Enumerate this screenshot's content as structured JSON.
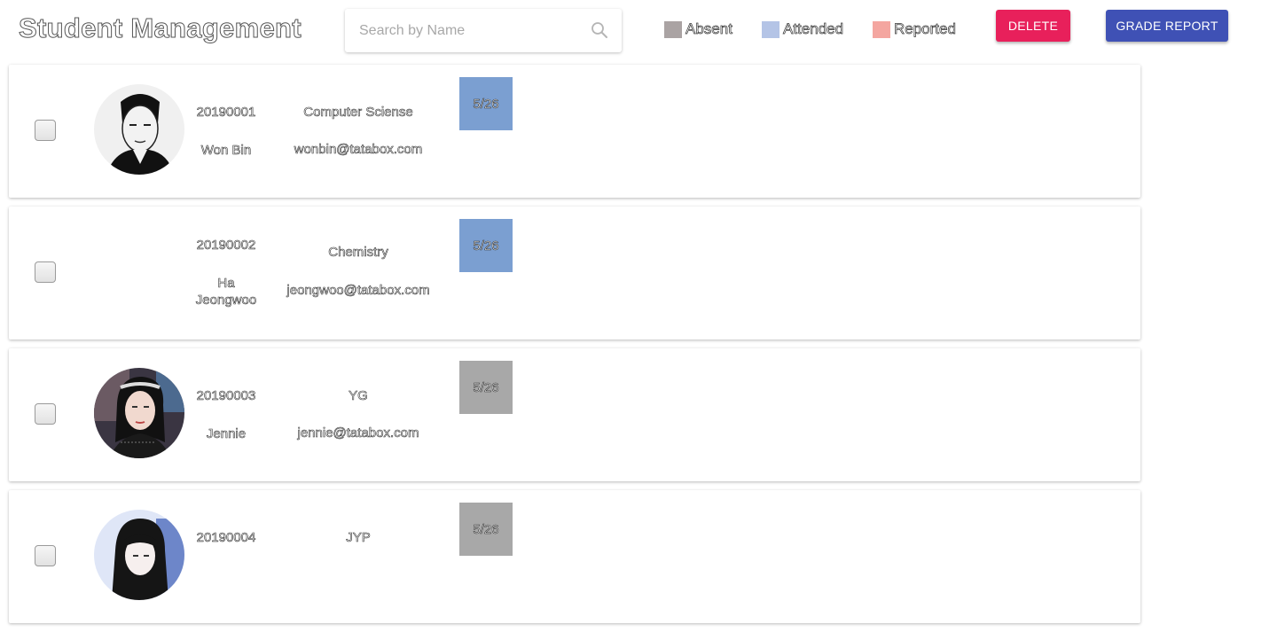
{
  "header": {
    "title": "Student Management",
    "search": {
      "placeholder": "Search by Name",
      "value": "",
      "icon": "search-icon"
    },
    "legend": [
      {
        "label": "Absent",
        "color": "#aaa3a3"
      },
      {
        "label": "Attended",
        "color": "#b4c4e6"
      },
      {
        "label": "Reported",
        "color": "#f4a6a0"
      }
    ],
    "buttons": {
      "delete_label": "DELETE",
      "delete_color": "#e8205b",
      "grade_report_label": "GRADE REPORT",
      "grade_report_color": "#3f51b5"
    }
  },
  "students": [
    {
      "id": "20190001",
      "name": "Won Bin",
      "major": "Computer Sciense",
      "email": "wonbin@tatabox.com",
      "attendance": [
        {
          "date": "5/26",
          "status": "Attended",
          "color": "#7b9fd1"
        }
      ],
      "has_photo": true
    },
    {
      "id": "20190002",
      "name": "Ha Jeongwoo",
      "major": "Chemistry",
      "email": "jeongwoo@tatabox.com",
      "attendance": [
        {
          "date": "5/26",
          "status": "Attended",
          "color": "#7b9fd1"
        }
      ],
      "has_photo": false
    },
    {
      "id": "20190003",
      "name": "Jennie",
      "major": "YG",
      "email": "jennie@tatabox.com",
      "attendance": [
        {
          "date": "5/26",
          "status": "Absent",
          "color": "#a8a8a8"
        }
      ],
      "has_photo": true
    },
    {
      "id": "20190004",
      "name": "",
      "major": "JYP",
      "email": "",
      "attendance": [
        {
          "date": "5/26",
          "status": "Absent",
          "color": "#a8a8a8"
        }
      ],
      "has_photo": true
    }
  ]
}
